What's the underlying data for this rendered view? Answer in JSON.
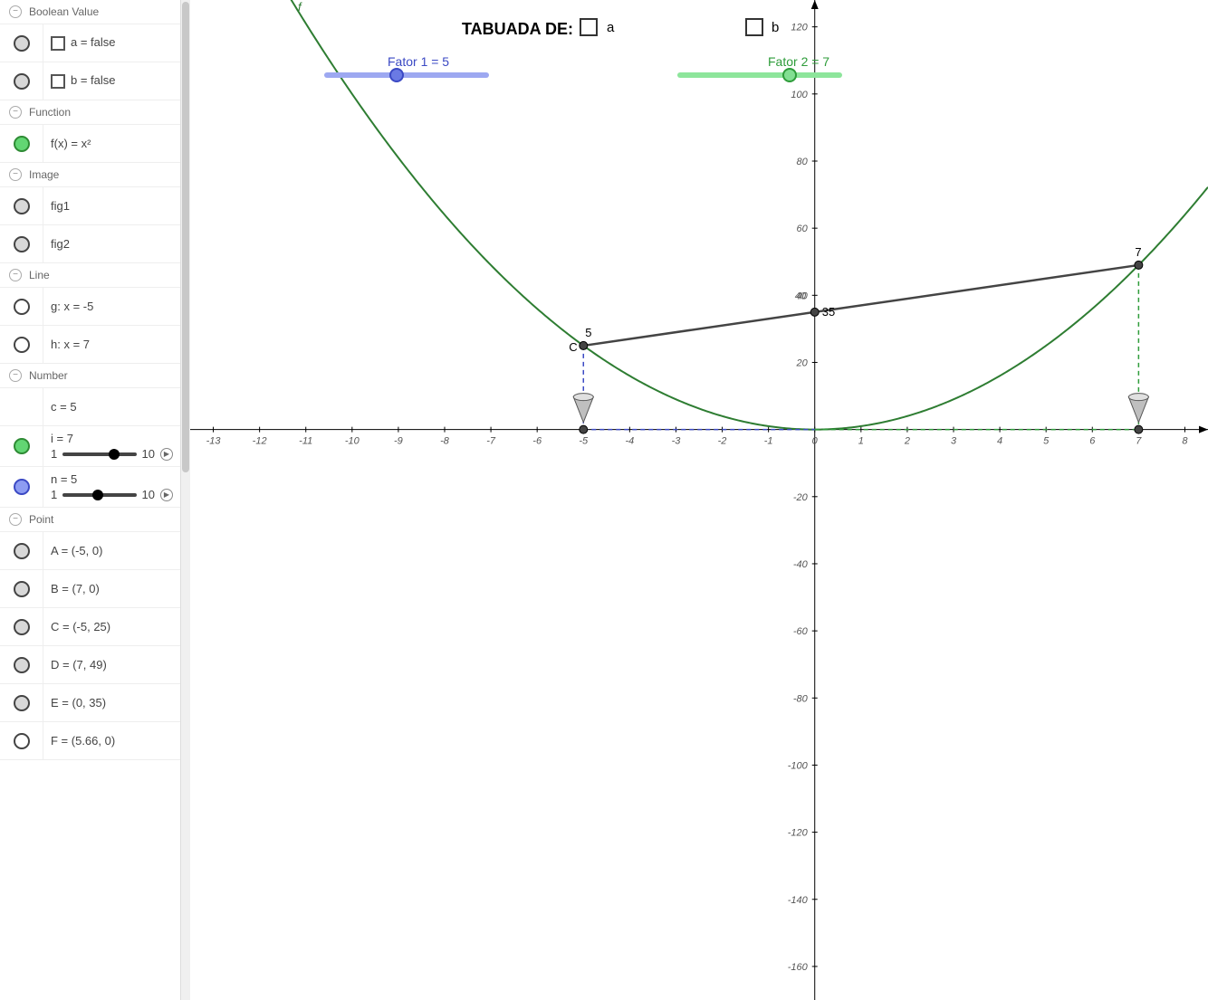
{
  "sidebar": {
    "sections": {
      "boolean_value": "Boolean Value",
      "function": "Function",
      "image": "Image",
      "line": "Line",
      "number": "Number",
      "point": "Point"
    },
    "items": {
      "a_bool": "a = false",
      "b_bool": "b = false",
      "f_func": "f(x) = x²",
      "fig1": "fig1",
      "fig2": "fig2",
      "g_line": "g: x = -5",
      "h_line": "h: x = 7",
      "c_num": "c = 5",
      "i_num_label": "i = 7",
      "n_num_label": "n = 5",
      "slider_min": "1",
      "slider_max": "10",
      "A": "A = (-5, 0)",
      "B": "B = (7, 0)",
      "C": "C = (-5, 25)",
      "D": "D = (7, 49)",
      "E": "E = (0, 35)",
      "F": "F = (5.66, 0)"
    }
  },
  "graph": {
    "title": "TABUADA DE:",
    "label_a": "a",
    "label_b": "b",
    "fator1": "Fator 1 = 5",
    "fator2": "Fator 2 = 7",
    "curve_label": "f",
    "point_C_label": "C",
    "point_C_val": "5",
    "point_D_val": "7",
    "point_E_vals": "35",
    "point_E_forty": "40",
    "x_ticks": [
      "-13",
      "-12",
      "-11",
      "-10",
      "-9",
      "-8",
      "-7",
      "-6",
      "-5",
      "-4",
      "-3",
      "-2",
      "-1",
      "0",
      "1",
      "2",
      "3",
      "4",
      "5",
      "6",
      "7",
      "8"
    ],
    "y_ticks_pos": [
      "20",
      "40",
      "60",
      "80",
      "100",
      "120"
    ],
    "y_ticks_neg": [
      "-20",
      "-40",
      "-60",
      "-80",
      "-100",
      "-120",
      "-140",
      "-160"
    ]
  },
  "chart_data": {
    "type": "line",
    "function": "f(x) = x^2",
    "x_range": [
      -13.5,
      8.5
    ],
    "y_range": [
      -170,
      128
    ],
    "parabola_points_visible_x": [
      -11.3,
      8
    ],
    "key_points": {
      "A": {
        "x": -5,
        "y": 0
      },
      "B": {
        "x": 7,
        "y": 0
      },
      "C": {
        "x": -5,
        "y": 25
      },
      "D": {
        "x": 7,
        "y": 49
      },
      "E": {
        "x": 0,
        "y": 35
      },
      "F": {
        "x": 5.66,
        "y": 0
      }
    },
    "secant_line": {
      "from": "C",
      "to": "D",
      "y_intercept": 35
    },
    "sliders": {
      "n": {
        "value": 5,
        "min": 1,
        "max": 10,
        "label": "Fator 1"
      },
      "i": {
        "value": 7,
        "min": 1,
        "max": 10,
        "label": "Fator 2"
      }
    },
    "vertical_lines": {
      "g": -5,
      "h": 7
    }
  }
}
